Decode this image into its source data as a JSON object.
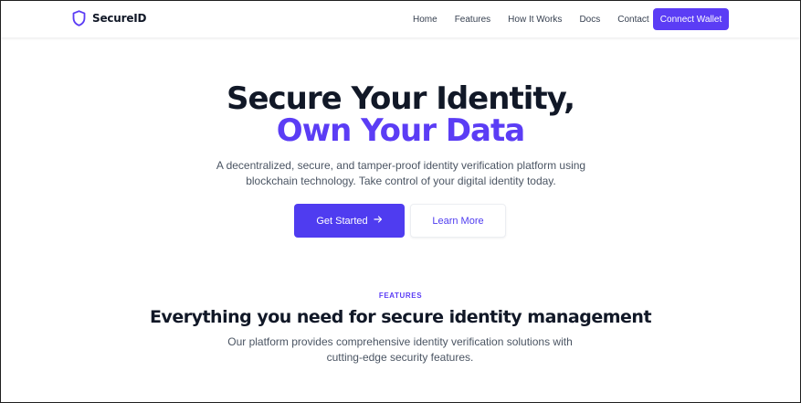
{
  "navbar": {
    "brand": "SecureID",
    "brand_icon": "shield-icon",
    "links": [
      {
        "label": "Home"
      },
      {
        "label": "Features"
      },
      {
        "label": "How It Works"
      },
      {
        "label": "Docs"
      },
      {
        "label": "Contact"
      }
    ],
    "connect_label": "Connect Wallet"
  },
  "hero": {
    "title_line1": "Secure Your Identity,",
    "title_line2": "Own Your Data",
    "description": "A decentralized, secure, and tamper-proof identity verification platform using blockchain technology. Take control of your digital identity today.",
    "primary_cta": "Get Started",
    "primary_cta_icon": "arrow-right-icon",
    "secondary_cta": "Learn More"
  },
  "features": {
    "tag": "FEATURES",
    "title": "Everything you need for secure identity management",
    "description": "Our platform provides comprehensive identity verification solutions with cutting-edge security features."
  },
  "colors": {
    "accent": "#5b3df5",
    "primary_button": "#4f3cf0",
    "heading": "#111827",
    "body_text": "#4b5563"
  }
}
